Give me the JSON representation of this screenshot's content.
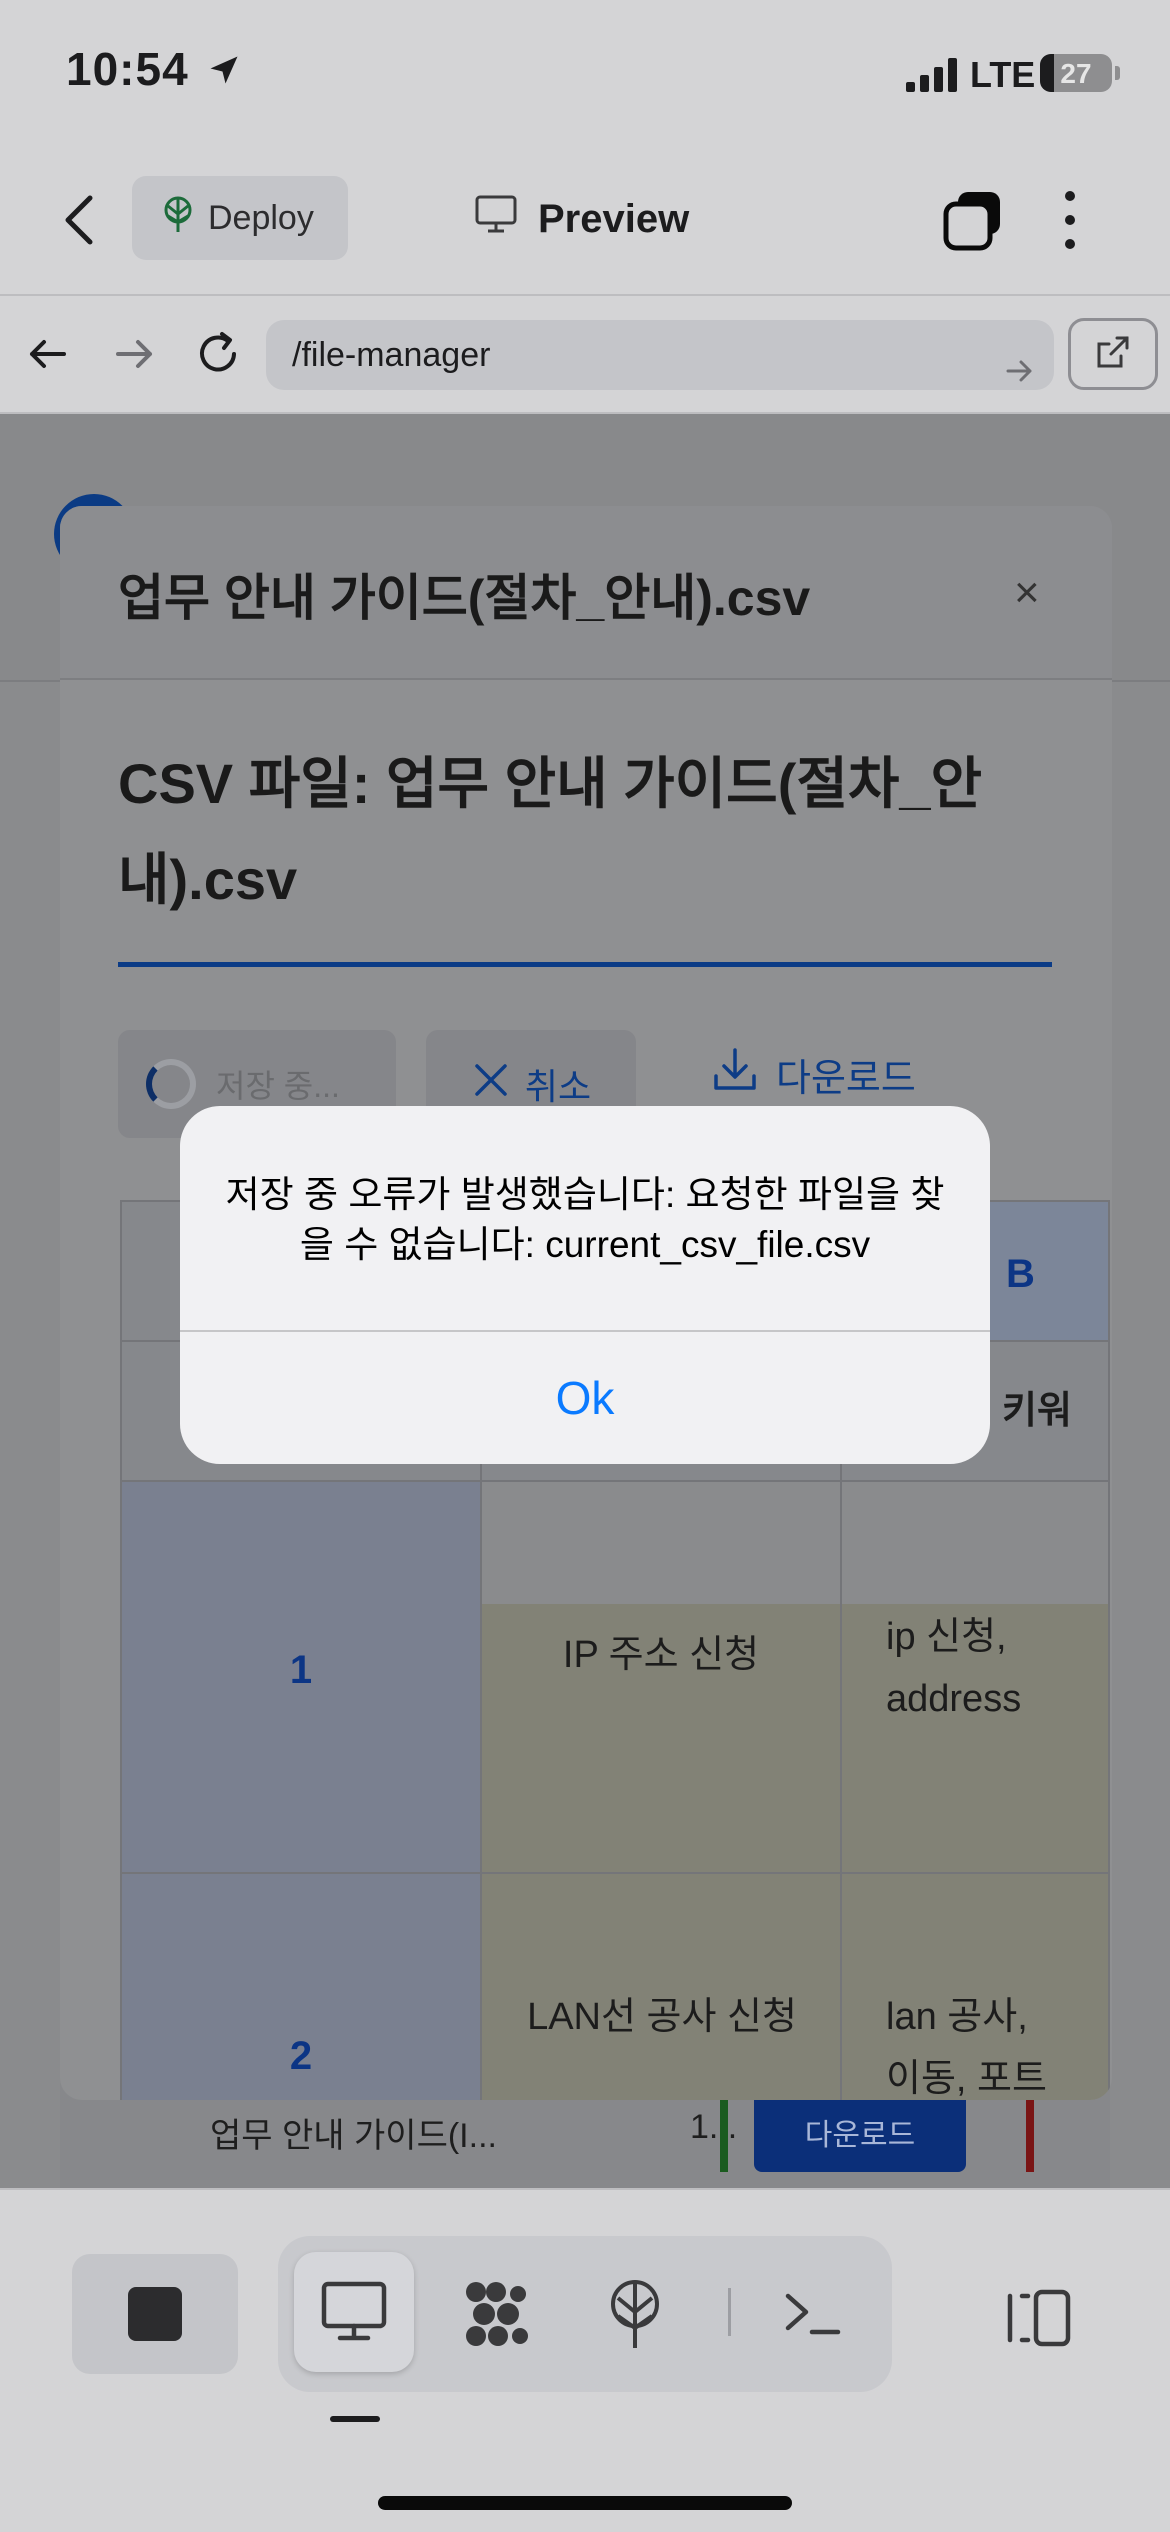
{
  "status_bar": {
    "time": "10:54",
    "network": "LTE",
    "battery": "27"
  },
  "header": {
    "deploy_label": "Deploy",
    "preview_label": "Preview"
  },
  "browser": {
    "url": "/file-manager"
  },
  "modal": {
    "title": "업무 안내 가이드(절차_안내).csv",
    "close_label": "×",
    "heading": "CSV 파일: 업무 안내 가이드(절차_안내).csv",
    "saving_label": "저장 중...",
    "cancel_label": "취소",
    "download_label": "다운로드",
    "table": {
      "col_b_label": "B",
      "header_partial": "키워",
      "rows": [
        {
          "num": "1",
          "title": "IP 주소 신청",
          "keywords": "ip 신청,\naddress"
        },
        {
          "num": "2",
          "title": "LAN선 공사 신청",
          "keywords": "lan 공사,\n이동, 포트"
        }
      ]
    }
  },
  "alert": {
    "message": "저장 중 오류가 발생했습니다: 요청한 파일을 찾을 수 없습니다: current_csv_file.csv",
    "ok_label": "Ok"
  },
  "background_row": {
    "name": "업무 안내 가이드(I...",
    "size": "1...",
    "download_label": "다운로드"
  },
  "colors": {
    "accent_blue": "#0a7aff",
    "brand_blue": "#0c3585"
  }
}
